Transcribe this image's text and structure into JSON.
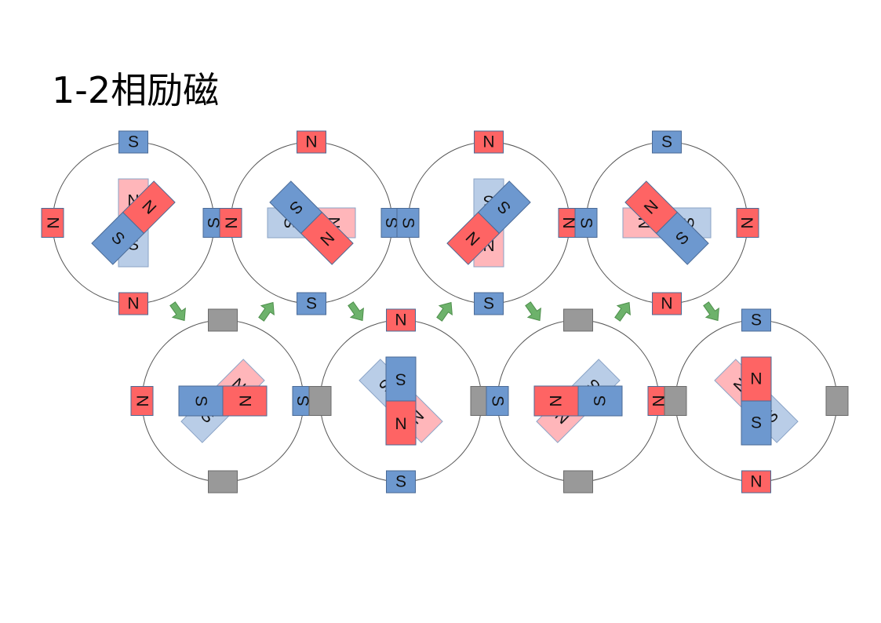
{
  "title": "1-2相励磁",
  "colors": {
    "north": "#fe6464",
    "south": "#6d98cf",
    "north_light": "#ffb6ba",
    "south_light": "#b9cde7",
    "unpowered": "#999999",
    "arrow": "#6db26b",
    "circle": "#555555"
  },
  "labels": {
    "north": "N",
    "south": "S"
  },
  "icons": {
    "step_arrow": "down-right-arrow / up-right-arrow"
  },
  "steps": [
    {
      "id": 1,
      "stator": {
        "top": "S",
        "bottom": "N",
        "left": "N",
        "right": "S"
      }
    },
    {
      "id": 2,
      "stator": {
        "top": "off",
        "bottom": "off",
        "left": "N",
        "right": "S"
      }
    },
    {
      "id": 3,
      "stator": {
        "top": "N",
        "bottom": "S",
        "left": "N",
        "right": "S"
      }
    },
    {
      "id": 4,
      "stator": {
        "top": "N",
        "bottom": "S",
        "left": "off",
        "right": "off"
      }
    },
    {
      "id": 5,
      "stator": {
        "top": "N",
        "bottom": "S",
        "left": "S",
        "right": "N"
      }
    },
    {
      "id": 6,
      "stator": {
        "top": "off",
        "bottom": "off",
        "left": "S",
        "right": "N"
      }
    },
    {
      "id": 7,
      "stator": {
        "top": "S",
        "bottom": "N",
        "left": "S",
        "right": "N"
      }
    },
    {
      "id": 8,
      "stator": {
        "top": "S",
        "bottom": "N",
        "left": "off",
        "right": "off"
      }
    }
  ]
}
